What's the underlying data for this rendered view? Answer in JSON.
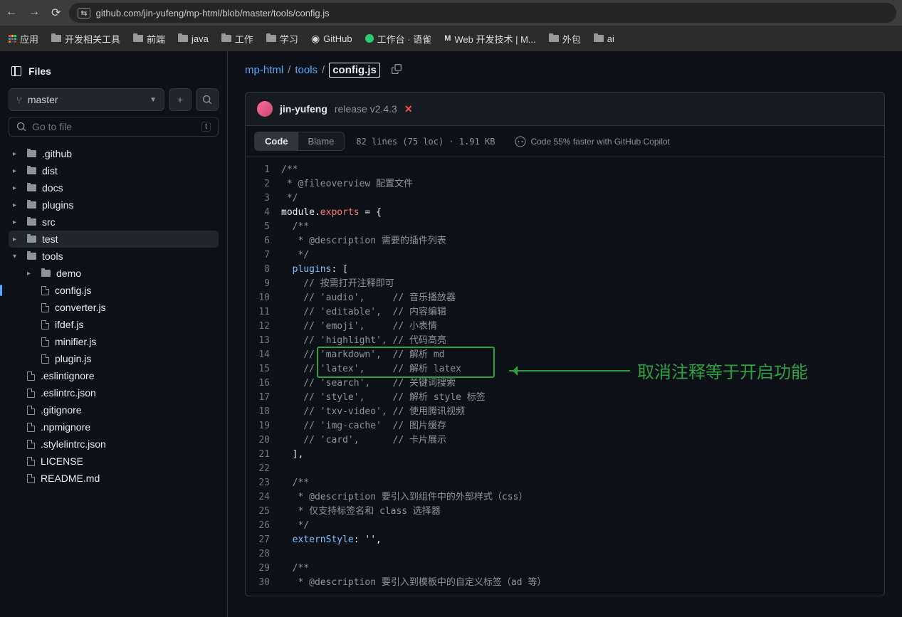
{
  "browser": {
    "url": "github.com/jin-yufeng/mp-html/blob/master/tools/config.js"
  },
  "bookmarks": {
    "apps": "应用",
    "items": [
      {
        "label": "开发相关工具",
        "type": "folder"
      },
      {
        "label": "前端",
        "type": "folder"
      },
      {
        "label": "java",
        "type": "folder"
      },
      {
        "label": "工作",
        "type": "folder"
      },
      {
        "label": "学习",
        "type": "folder"
      },
      {
        "label": "GitHub",
        "type": "github"
      },
      {
        "label": "工作台 · 语雀",
        "type": "yuque"
      },
      {
        "label": "Web 开发技术 | M...",
        "type": "mdn"
      },
      {
        "label": "外包",
        "type": "folder"
      },
      {
        "label": "ai",
        "type": "folder"
      }
    ]
  },
  "sidebar": {
    "title": "Files",
    "branch": "master",
    "search_placeholder": "Go to file",
    "kbd": "t",
    "tree": [
      {
        "name": ".github",
        "type": "dir",
        "indent": 0,
        "expanded": false
      },
      {
        "name": "dist",
        "type": "dir",
        "indent": 0,
        "expanded": false
      },
      {
        "name": "docs",
        "type": "dir",
        "indent": 0,
        "expanded": false
      },
      {
        "name": "plugins",
        "type": "dir",
        "indent": 0,
        "expanded": false
      },
      {
        "name": "src",
        "type": "dir",
        "indent": 0,
        "expanded": false
      },
      {
        "name": "test",
        "type": "dir",
        "indent": 0,
        "expanded": false,
        "active": true
      },
      {
        "name": "tools",
        "type": "dir",
        "indent": 0,
        "expanded": true
      },
      {
        "name": "demo",
        "type": "dir",
        "indent": 1,
        "expanded": false
      },
      {
        "name": "config.js",
        "type": "file",
        "indent": 1,
        "current": true
      },
      {
        "name": "converter.js",
        "type": "file",
        "indent": 1
      },
      {
        "name": "ifdef.js",
        "type": "file",
        "indent": 1
      },
      {
        "name": "minifier.js",
        "type": "file",
        "indent": 1
      },
      {
        "name": "plugin.js",
        "type": "file",
        "indent": 1
      },
      {
        "name": ".eslintignore",
        "type": "file",
        "indent": 0
      },
      {
        "name": ".eslintrc.json",
        "type": "file",
        "indent": 0
      },
      {
        "name": ".gitignore",
        "type": "file",
        "indent": 0
      },
      {
        "name": ".npmignore",
        "type": "file",
        "indent": 0
      },
      {
        "name": ".stylelintrc.json",
        "type": "file",
        "indent": 0
      },
      {
        "name": "LICENSE",
        "type": "file",
        "indent": 0
      },
      {
        "name": "README.md",
        "type": "file",
        "indent": 0
      }
    ]
  },
  "breadcrumb": {
    "root": "mp-html",
    "mid": "tools",
    "file": "config.js"
  },
  "commit": {
    "author": "jin-yufeng",
    "message": "release v2.4.3"
  },
  "tabs": {
    "code": "Code",
    "blame": "Blame"
  },
  "file_meta": "82 lines (75 loc) · 1.91 KB",
  "copilot": "Code 55% faster with GitHub Copilot",
  "code_lines": [
    {
      "n": 1,
      "t": "/**",
      "cls": "cmt"
    },
    {
      "n": 2,
      "t": " * @fileoverview 配置文件",
      "cls": "cmt"
    },
    {
      "n": 3,
      "t": " */",
      "cls": "cmt"
    },
    {
      "n": 4,
      "t": "module.<kw>exports</kw> = {"
    },
    {
      "n": 5,
      "t": "  /**",
      "cls": "cmt"
    },
    {
      "n": 6,
      "t": "   * @description 需要的插件列表",
      "cls": "cmt"
    },
    {
      "n": 7,
      "t": "   */",
      "cls": "cmt"
    },
    {
      "n": 8,
      "t": "  <prop>plugins</prop>: ["
    },
    {
      "n": 9,
      "t": "    // 按需打开注释即可",
      "cls": "cmt"
    },
    {
      "n": 10,
      "t": "    // 'audio',     // 音乐播放器",
      "cls": "cmt"
    },
    {
      "n": 11,
      "t": "    // 'editable',  // 内容编辑",
      "cls": "cmt"
    },
    {
      "n": 12,
      "t": "    // 'emoji',     // 小表情",
      "cls": "cmt"
    },
    {
      "n": 13,
      "t": "    // 'highlight', // 代码高亮",
      "cls": "cmt"
    },
    {
      "n": 14,
      "t": "    // 'markdown',  // 解析 md",
      "cls": "cmt"
    },
    {
      "n": 15,
      "t": "    // 'latex',     // 解析 latex",
      "cls": "cmt"
    },
    {
      "n": 16,
      "t": "    // 'search',    // 关键词搜索",
      "cls": "cmt"
    },
    {
      "n": 17,
      "t": "    // 'style',     // 解析 style 标签",
      "cls": "cmt"
    },
    {
      "n": 18,
      "t": "    // 'txv-video', // 使用腾讯视频",
      "cls": "cmt"
    },
    {
      "n": 19,
      "t": "    // 'img-cache'  // 图片缓存",
      "cls": "cmt"
    },
    {
      "n": 20,
      "t": "    // 'card',      // 卡片展示",
      "cls": "cmt"
    },
    {
      "n": 21,
      "t": "  ],"
    },
    {
      "n": 22,
      "t": ""
    },
    {
      "n": 23,
      "t": "  /**",
      "cls": "cmt"
    },
    {
      "n": 24,
      "t": "   * @description 要引入到组件中的外部样式（css）",
      "cls": "cmt"
    },
    {
      "n": 25,
      "t": "   * 仅支持标签名和 class 选择器",
      "cls": "cmt"
    },
    {
      "n": 26,
      "t": "   */",
      "cls": "cmt"
    },
    {
      "n": 27,
      "t": "  <prop>externStyle</prop>: '',"
    },
    {
      "n": 28,
      "t": ""
    },
    {
      "n": 29,
      "t": "  /**",
      "cls": "cmt"
    },
    {
      "n": 30,
      "t": "   * @description 要引入到模板中的自定义标签（ad 等）",
      "cls": "cmt"
    }
  ],
  "annotation": {
    "text": "取消注释等于开启功能",
    "highlight_line": 15
  }
}
